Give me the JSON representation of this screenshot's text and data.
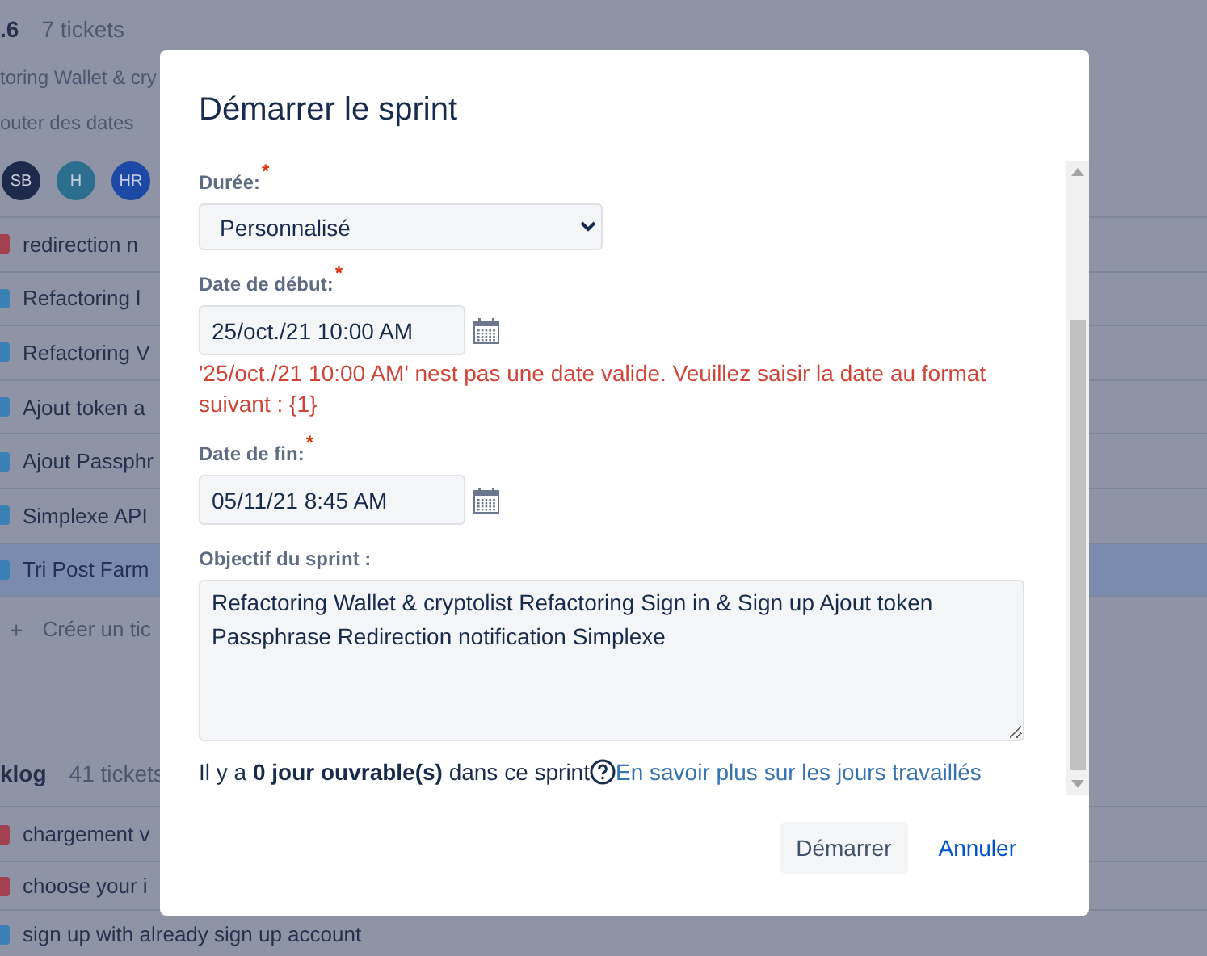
{
  "background": {
    "sprint": {
      "name": ".6",
      "count": "7 tickets",
      "goal": "toring Wallet & cry",
      "add_dates": "outer des dates",
      "assignees": [
        {
          "initials": "SB",
          "color": "#1d2a4b"
        },
        {
          "initials": "H",
          "color": "#2c6e8e"
        },
        {
          "initials": "HR",
          "color": "#1c48a6"
        }
      ],
      "issues": [
        {
          "title": "redirection n",
          "kind": "bug",
          "selected": false
        },
        {
          "title": "Refactoring l",
          "kind": "task",
          "selected": false
        },
        {
          "title": "Refactoring V",
          "kind": "task",
          "selected": false
        },
        {
          "title": "Ajout token a",
          "kind": "task",
          "selected": false
        },
        {
          "title": "Ajout Passphr",
          "kind": "task",
          "selected": false
        },
        {
          "title": "Simplexe API",
          "kind": "task",
          "selected": false
        },
        {
          "title": "Tri Post Farm",
          "kind": "task",
          "selected": true
        }
      ],
      "create_icon": "+",
      "create_label": "Créer un tic"
    },
    "backlog": {
      "name": "klog",
      "count": "41 tickets",
      "issues": [
        {
          "title": "chargement v",
          "kind": "bug",
          "selected": false
        },
        {
          "title": "choose your i",
          "kind": "bug",
          "selected": false
        },
        {
          "title": "sign up with already sign up account",
          "kind": "task",
          "selected": false
        }
      ]
    }
  },
  "dialog": {
    "title": "Démarrer le sprint",
    "fields": [
      {
        "kind": "select",
        "label": "Durée:",
        "marker": "*",
        "value": "Personnalisé"
      },
      {
        "kind": "date",
        "label": "Date de début:",
        "marker": "*",
        "value": "25/oct./21 10:00 AM",
        "error": "'25/oct./21 10:00 AM' nest pas une date valide. Veuillez saisir la date au format suivant : {1}"
      },
      {
        "kind": "date",
        "label": "Date de fin:",
        "marker": "*",
        "value": "05/11/21 8:45 AM"
      },
      {
        "kind": "textarea",
        "label": "Objectif du sprint :",
        "value": "Refactoring Wallet & cryptolist Refactoring Sign in & Sign up Ajout token Passphrase Redirection notification Simplexe"
      }
    ],
    "summary": "Il y a **0 jour ouvrable(s)** dans ce sprint",
    "link": "En savoir plus sur les jours travaillés",
    "buttons": [
      {
        "label": "Démarrer",
        "kind": "secondary"
      },
      {
        "label": "Annuler",
        "kind": "link"
      }
    ]
  }
}
